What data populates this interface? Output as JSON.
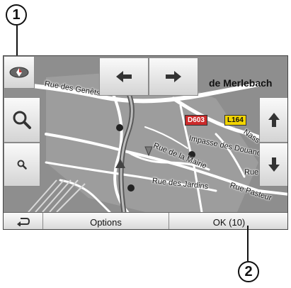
{
  "callouts": {
    "first": "1",
    "second": "2"
  },
  "map": {
    "place_label": "de Merlebach",
    "roads": {
      "genets": "Rue des Genêts",
      "douane": "Impasse des Douanes",
      "mairie": "Rue de la Mairie",
      "jardins": "Rue des Jardins",
      "pasteur": "Rue Pasteur",
      "rue": "Rue",
      "nass": "Nass"
    },
    "shields": {
      "d603": "D603",
      "l164": "L164"
    }
  },
  "toolbar": {
    "compass_icon": "compass-icon",
    "left_icon": "arrow-left-icon",
    "right_icon": "arrow-right-icon",
    "zoom_in_icon": "magnifier-large-icon",
    "zoom_out_icon": "magnifier-small-icon",
    "up_icon": "arrow-up-icon",
    "down_icon": "arrow-down-icon"
  },
  "bottom_bar": {
    "back_icon": "return-arrow-icon",
    "options_label": "Options",
    "ok_label": "OK (10)"
  },
  "colors": {
    "map_bg": "#8e8e8e",
    "road": "#ffffff",
    "button": "#e9e9e9",
    "shield_red": "#cc2a2a",
    "shield_yellow": "#f2d400"
  }
}
